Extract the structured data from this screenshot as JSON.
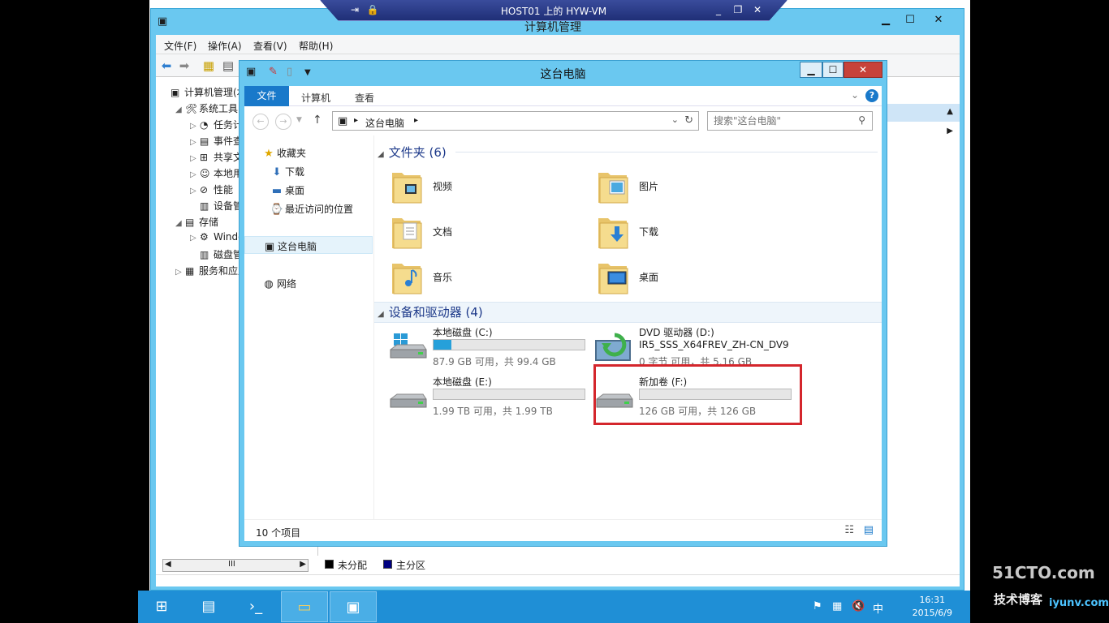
{
  "remote_bar": {
    "title": "HOST01 上的 HYW-VM",
    "pin_icon": "pin-icon",
    "lock_icon": "lock-icon",
    "minimize": "_",
    "restore": "❐",
    "close": "✕"
  },
  "back_window": {
    "title": "计算机管理",
    "menu": [
      "文件(F)",
      "操作(A)",
      "查看(V)",
      "帮助(H)"
    ],
    "tree": [
      {
        "label": "计算机管理(本",
        "indent": 0,
        "toggle": ""
      },
      {
        "label": "系统工具",
        "indent": 1,
        "toggle": "◢"
      },
      {
        "label": "任务计",
        "indent": 2,
        "toggle": "▷"
      },
      {
        "label": "事件查",
        "indent": 2,
        "toggle": "▷"
      },
      {
        "label": "共享文",
        "indent": 2,
        "toggle": "▷"
      },
      {
        "label": "本地用",
        "indent": 2,
        "toggle": "▷"
      },
      {
        "label": "性能",
        "indent": 2,
        "toggle": "▷"
      },
      {
        "label": "设备管",
        "indent": 2,
        "toggle": ""
      },
      {
        "label": "存储",
        "indent": 1,
        "toggle": "◢"
      },
      {
        "label": "Windo",
        "indent": 2,
        "toggle": "▷"
      },
      {
        "label": "磁盘管",
        "indent": 2,
        "toggle": ""
      },
      {
        "label": "服务和应用",
        "indent": 1,
        "toggle": "▷"
      }
    ],
    "legend": [
      {
        "label": "未分配",
        "color": "#000000"
      },
      {
        "label": "主分区",
        "color": "#000080"
      }
    ],
    "scroll_mark": "III"
  },
  "explorer": {
    "title": "这台电脑",
    "ribbon_tabs": [
      "文件",
      "计算机",
      "查看"
    ],
    "help": "?",
    "address": "这台电脑",
    "search_placeholder": "搜索\"这台电脑\"",
    "nav": [
      {
        "label": "收藏夹",
        "icon": "star-icon",
        "glyph": "★"
      },
      {
        "label": "下载",
        "icon": "download-icon",
        "glyph": "⬇"
      },
      {
        "label": "桌面",
        "icon": "desktop-icon",
        "glyph": "▬"
      },
      {
        "label": "最近访问的位置",
        "icon": "recent-icon",
        "glyph": "⌚"
      },
      {
        "label": "这台电脑",
        "icon": "computer-icon",
        "glyph": "▣"
      },
      {
        "label": "网络",
        "icon": "network-icon",
        "glyph": "◍"
      }
    ],
    "folders_header": "文件夹 (6)",
    "folders": [
      {
        "label": "视频",
        "icon": "video-folder-icon"
      },
      {
        "label": "图片",
        "icon": "picture-folder-icon"
      },
      {
        "label": "文档",
        "icon": "document-folder-icon"
      },
      {
        "label": "下载",
        "icon": "download-folder-icon"
      },
      {
        "label": "音乐",
        "icon": "music-folder-icon"
      },
      {
        "label": "桌面",
        "icon": "desktop-folder-icon"
      }
    ],
    "drives_header": "设备和驱动器 (4)",
    "drives": [
      {
        "name": "本地磁盘 (C:)",
        "sub": "",
        "status": "87.9 GB 可用，共 99.4 GB",
        "used_fraction": 0.116,
        "has_bar": true,
        "type": "system"
      },
      {
        "name": "DVD 驱动器 (D:)",
        "sub": "IR5_SSS_X64FREV_ZH-CN_DV9",
        "status": "0 字节 可用，共 5.16 GB",
        "used_fraction": 1,
        "has_bar": false,
        "type": "dvd"
      },
      {
        "name": "本地磁盘 (E:)",
        "sub": "",
        "status": "1.99 TB 可用，共 1.99 TB",
        "used_fraction": 0.0,
        "has_bar": true,
        "type": "disk"
      },
      {
        "name": "新加卷 (F:)",
        "sub": "",
        "status": "126 GB 可用，共 126 GB",
        "used_fraction": 0.0,
        "has_bar": true,
        "type": "disk"
      }
    ],
    "status_count": "10 个项目"
  },
  "taskbar": {
    "items": [
      {
        "name": "start-button",
        "glyph": "⊞"
      },
      {
        "name": "server-manager-button",
        "glyph": "▤"
      },
      {
        "name": "powershell-button",
        "glyph": "›_"
      },
      {
        "name": "file-explorer-button",
        "glyph": "▭"
      },
      {
        "name": "computer-management-button",
        "glyph": "▣"
      }
    ],
    "ime": "中",
    "time": "16:31",
    "date": "2015/6/9"
  },
  "watermark": {
    "brand": "51CTO.com",
    "line2": "技术博客",
    "site": "iyunv.com"
  }
}
